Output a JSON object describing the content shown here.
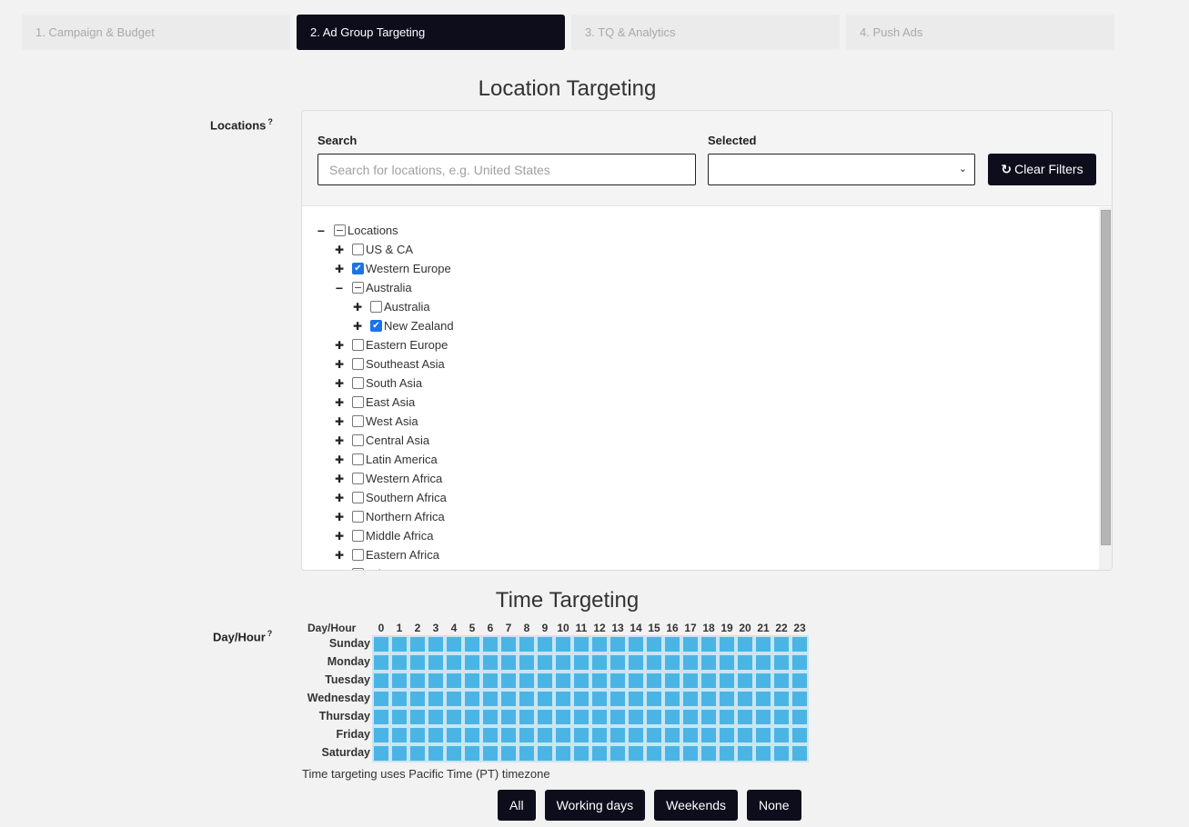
{
  "steps": [
    {
      "label": "1. Campaign & Budget",
      "active": false
    },
    {
      "label": "2. Ad Group Targeting",
      "active": true
    },
    {
      "label": "3. TQ & Analytics",
      "active": false
    },
    {
      "label": "4. Push Ads",
      "active": false
    }
  ],
  "location": {
    "heading": "Location Targeting",
    "field_label": "Locations",
    "help_mark": "?",
    "search_label": "Search",
    "search_placeholder": "Search for locations, e.g. United States",
    "search_value": "",
    "selected_label": "Selected",
    "selected_value": "",
    "clear_label": "Clear Filters",
    "tree": [
      {
        "label": "Locations",
        "level": 0,
        "toggle": "minus",
        "state": "partial"
      },
      {
        "label": "US & CA",
        "level": 1,
        "toggle": "plus",
        "state": "unchecked"
      },
      {
        "label": "Western Europe",
        "level": 1,
        "toggle": "plus",
        "state": "checked"
      },
      {
        "label": "Australia",
        "level": 1,
        "toggle": "minus",
        "state": "partial"
      },
      {
        "label": "Australia",
        "level": 2,
        "toggle": "plus",
        "state": "unchecked"
      },
      {
        "label": "New Zealand",
        "level": 2,
        "toggle": "plus",
        "state": "checked"
      },
      {
        "label": "Eastern Europe",
        "level": 1,
        "toggle": "plus",
        "state": "unchecked"
      },
      {
        "label": "Southeast Asia",
        "level": 1,
        "toggle": "plus",
        "state": "unchecked"
      },
      {
        "label": "South Asia",
        "level": 1,
        "toggle": "plus",
        "state": "unchecked"
      },
      {
        "label": "East Asia",
        "level": 1,
        "toggle": "plus",
        "state": "unchecked"
      },
      {
        "label": "West Asia",
        "level": 1,
        "toggle": "plus",
        "state": "unchecked"
      },
      {
        "label": "Central Asia",
        "level": 1,
        "toggle": "plus",
        "state": "unchecked"
      },
      {
        "label": "Latin America",
        "level": 1,
        "toggle": "plus",
        "state": "unchecked"
      },
      {
        "label": "Western Africa",
        "level": 1,
        "toggle": "plus",
        "state": "unchecked"
      },
      {
        "label": "Southern Africa",
        "level": 1,
        "toggle": "plus",
        "state": "unchecked"
      },
      {
        "label": "Northern Africa",
        "level": 1,
        "toggle": "plus",
        "state": "unchecked"
      },
      {
        "label": "Middle Africa",
        "level": 1,
        "toggle": "plus",
        "state": "unchecked"
      },
      {
        "label": "Eastern Africa",
        "level": 1,
        "toggle": "plus",
        "state": "unchecked"
      },
      {
        "label": "Other",
        "level": 1,
        "toggle": "plus",
        "state": "unchecked"
      }
    ]
  },
  "time": {
    "heading": "Time Targeting",
    "field_label": "Day/Hour",
    "help_mark": "?",
    "corner_label": "Day/Hour",
    "hours": [
      "0",
      "1",
      "2",
      "3",
      "4",
      "5",
      "6",
      "7",
      "8",
      "9",
      "10",
      "11",
      "12",
      "13",
      "14",
      "15",
      "16",
      "17",
      "18",
      "19",
      "20",
      "21",
      "22",
      "23"
    ],
    "days": [
      "Sunday",
      "Monday",
      "Tuesday",
      "Wednesday",
      "Thursday",
      "Friday",
      "Saturday"
    ],
    "all_selected": true,
    "selected_color": "#4ab5e5",
    "timezone_note": "Time targeting uses Pacific Time (PT) timezone",
    "buttons": [
      "All",
      "Working days",
      "Weekends",
      "None"
    ]
  }
}
